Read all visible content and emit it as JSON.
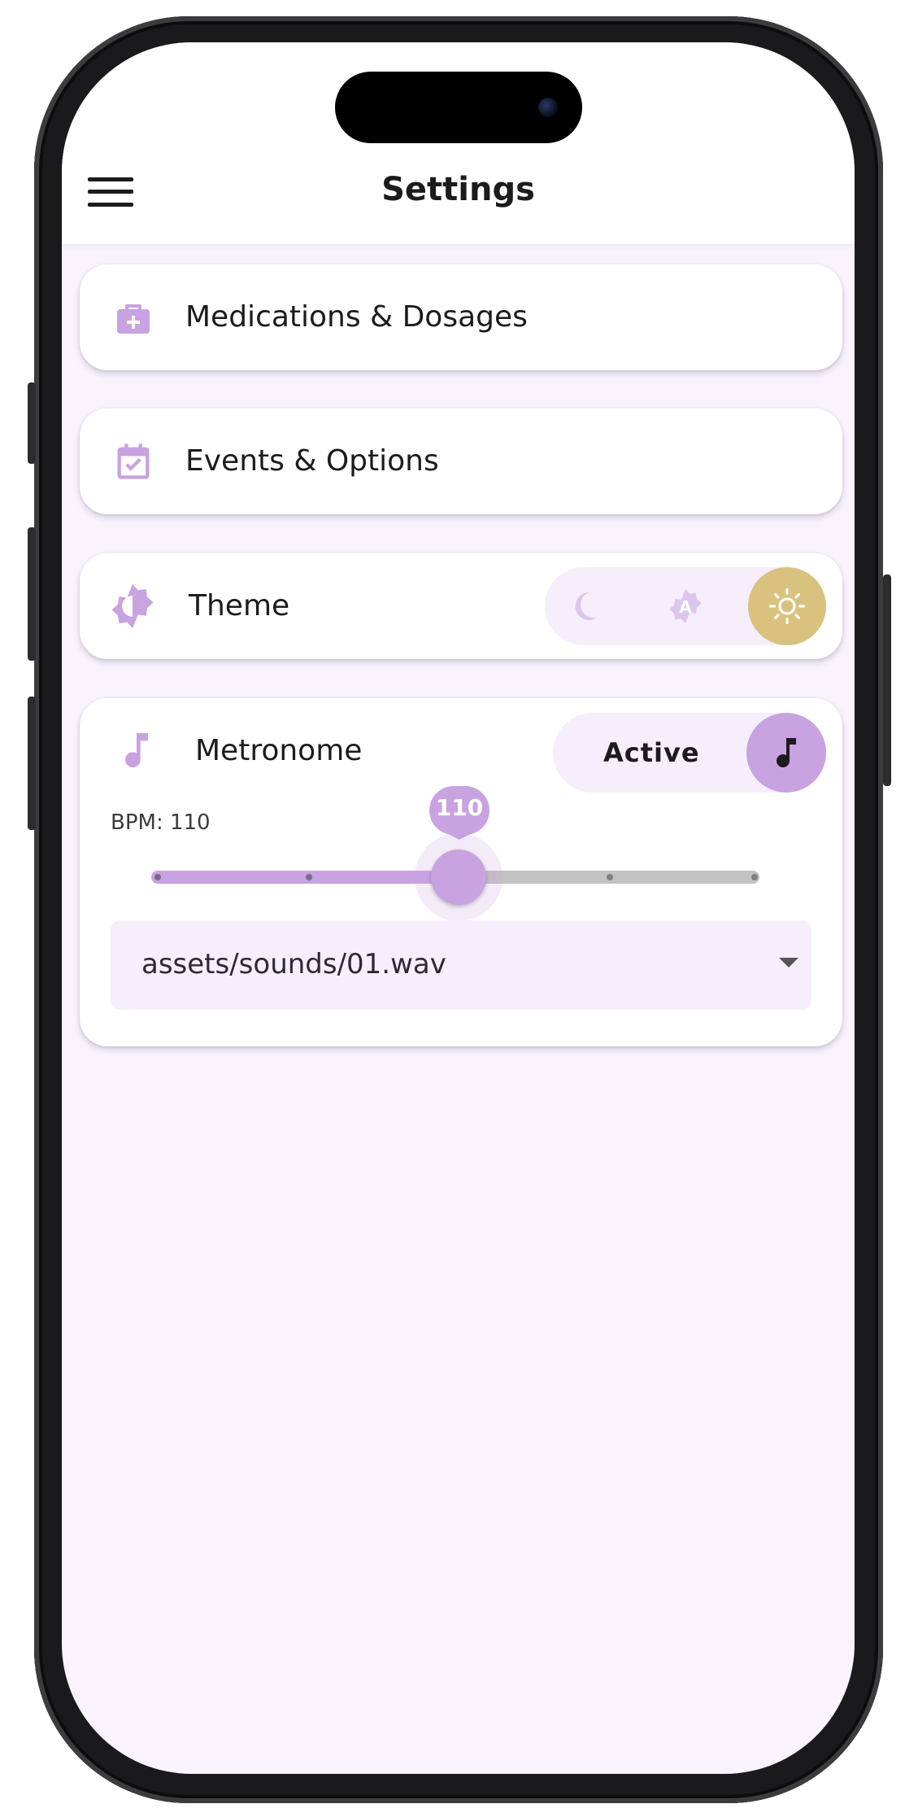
{
  "app": {
    "title": "Settings"
  },
  "icons": {
    "menu": "menu-icon",
    "medications": "medical-bag-icon",
    "events": "calendar-check-icon",
    "theme": "brightness-icon",
    "dark_mode": "moon-icon",
    "auto_mode": "brightness-auto-icon",
    "light_mode": "sun-icon",
    "metronome": "music-note-icon",
    "metronome_toggle": "music-note-icon",
    "dropdown": "caret-down-icon"
  },
  "settings": {
    "medications": {
      "label": "Medications & Dosages"
    },
    "events": {
      "label": "Events & Options"
    },
    "theme": {
      "label": "Theme",
      "options": [
        "dark",
        "auto",
        "light"
      ],
      "selected": "light"
    },
    "metronome": {
      "label": "Metronome",
      "toggle_label": "Active",
      "bpm_label": "BPM: 110",
      "bpm_value": "110",
      "slider_fraction": 0.5,
      "sound": {
        "selected": "assets/sounds/01.wav"
      }
    }
  },
  "colors": {
    "accent": "#c8a2e1",
    "accent_light": "#f6eefb",
    "theme_selected": "#d8c27e",
    "background": "#f9f3fd",
    "card": "#ffffff",
    "text": "#1c1b1f"
  }
}
